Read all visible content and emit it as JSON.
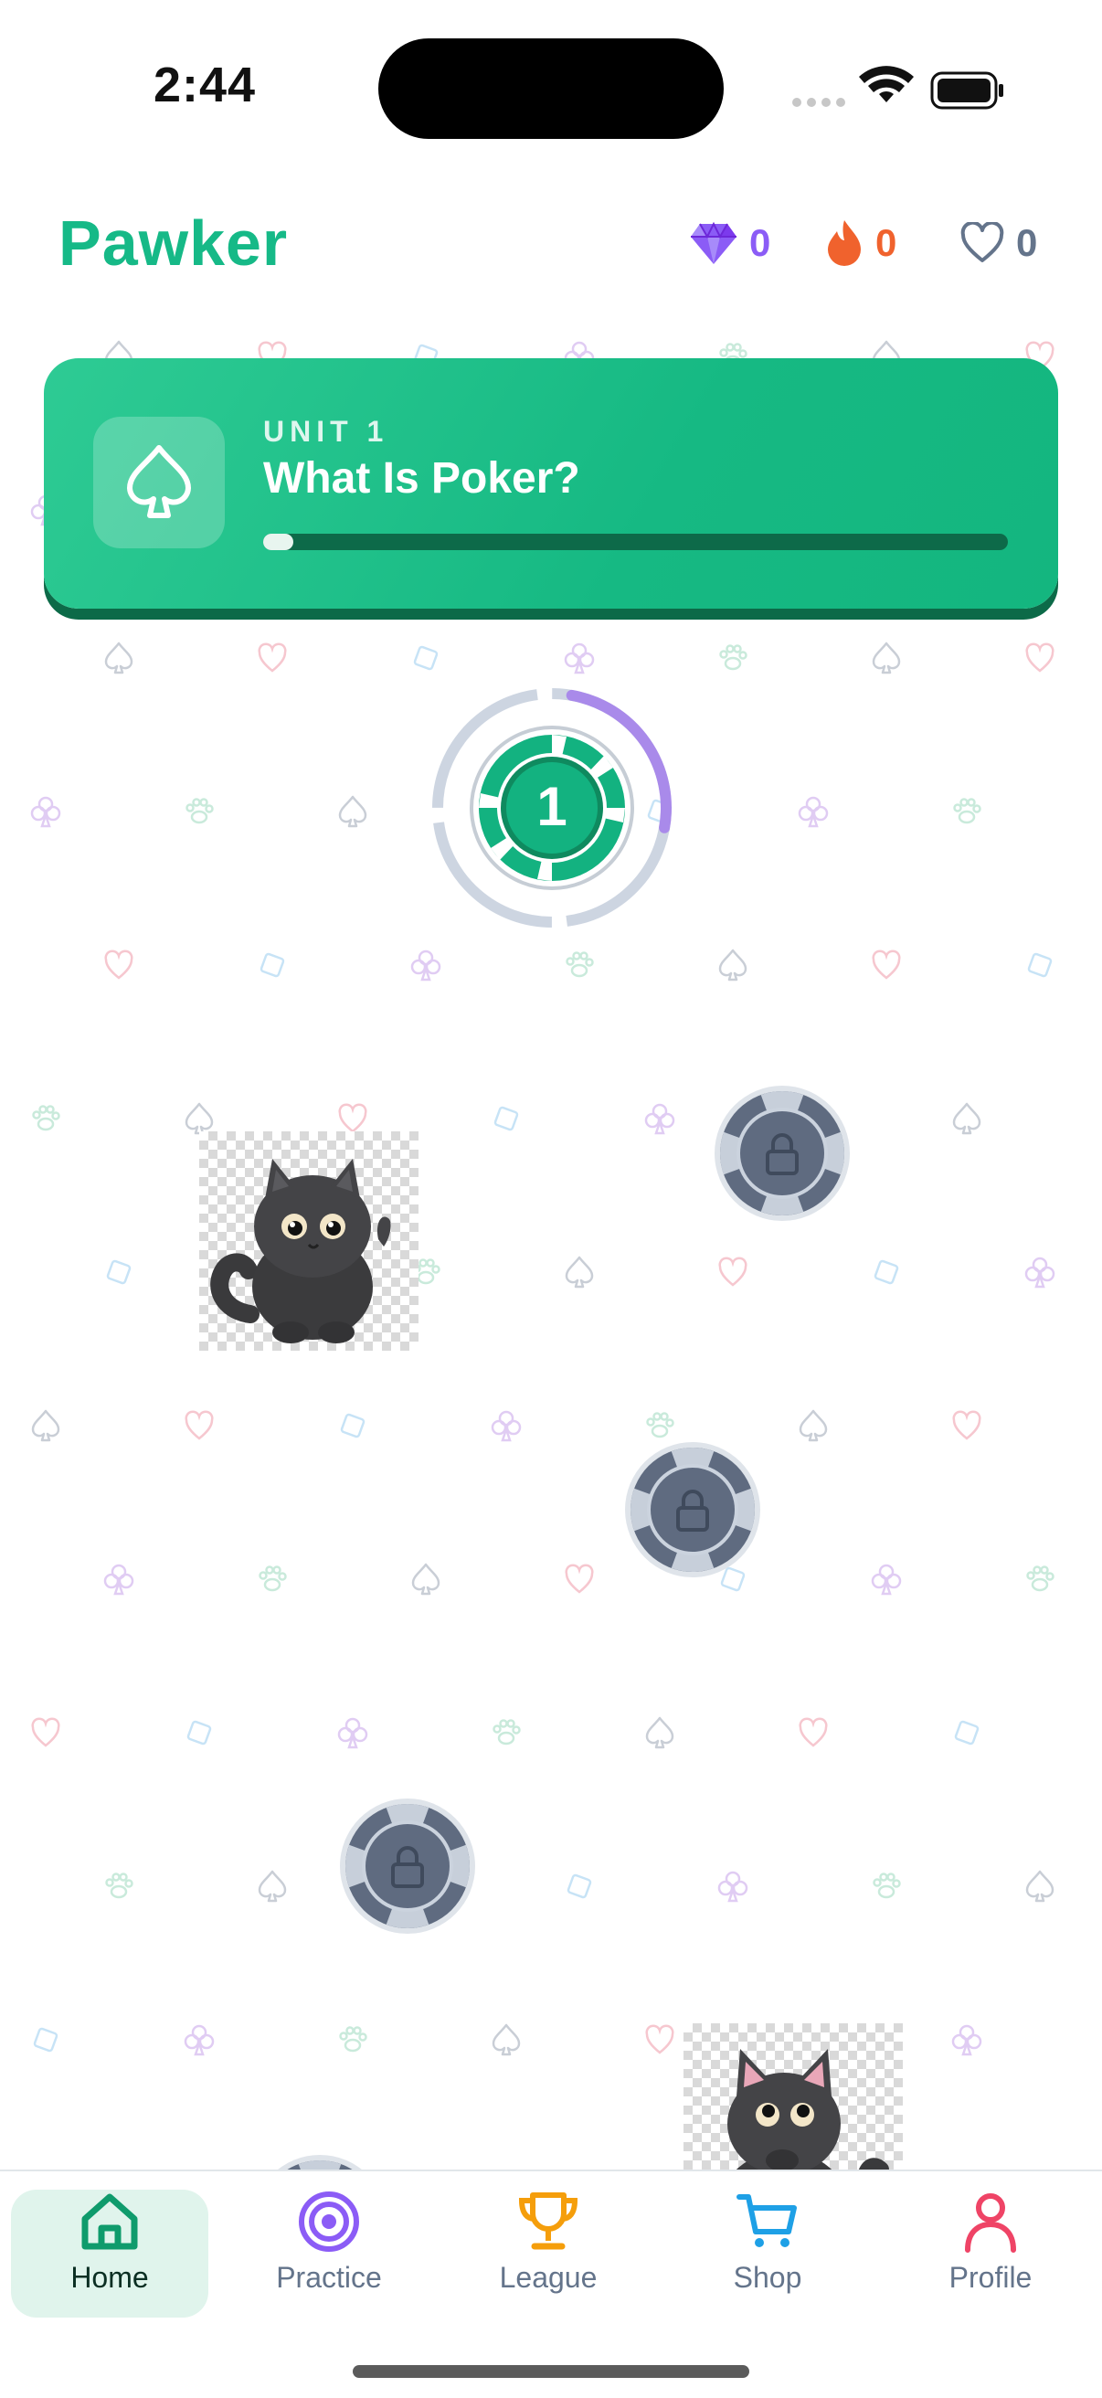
{
  "status_bar": {
    "time": "2:44"
  },
  "header": {
    "brand": "Pawker",
    "gems": "0",
    "streak": "0",
    "hearts": "0",
    "colors": {
      "brand": "#16b987",
      "gems": "#8b5cf6",
      "streak": "#f0622d",
      "hearts": "#64748b"
    }
  },
  "unit": {
    "label": "UNIT 1",
    "title": "What Is Poker?",
    "progress": 0.04,
    "icon": "spade-icon"
  },
  "path": {
    "current_lesson_number": "1",
    "current_lesson_progress": 0.25,
    "locked_icon": "lock-icon"
  },
  "tabs": [
    {
      "label": "Home",
      "icon": "home-icon",
      "color": "#0f9b6c",
      "active": true
    },
    {
      "label": "Practice",
      "icon": "target-icon",
      "color": "#8b5cf6",
      "active": false
    },
    {
      "label": "League",
      "icon": "trophy-icon",
      "color": "#f59e0b",
      "active": false
    },
    {
      "label": "Shop",
      "icon": "cart-icon",
      "color": "#1ea0e6",
      "active": false
    },
    {
      "label": "Profile",
      "icon": "user-icon",
      "color": "#ef4466",
      "active": false
    }
  ]
}
